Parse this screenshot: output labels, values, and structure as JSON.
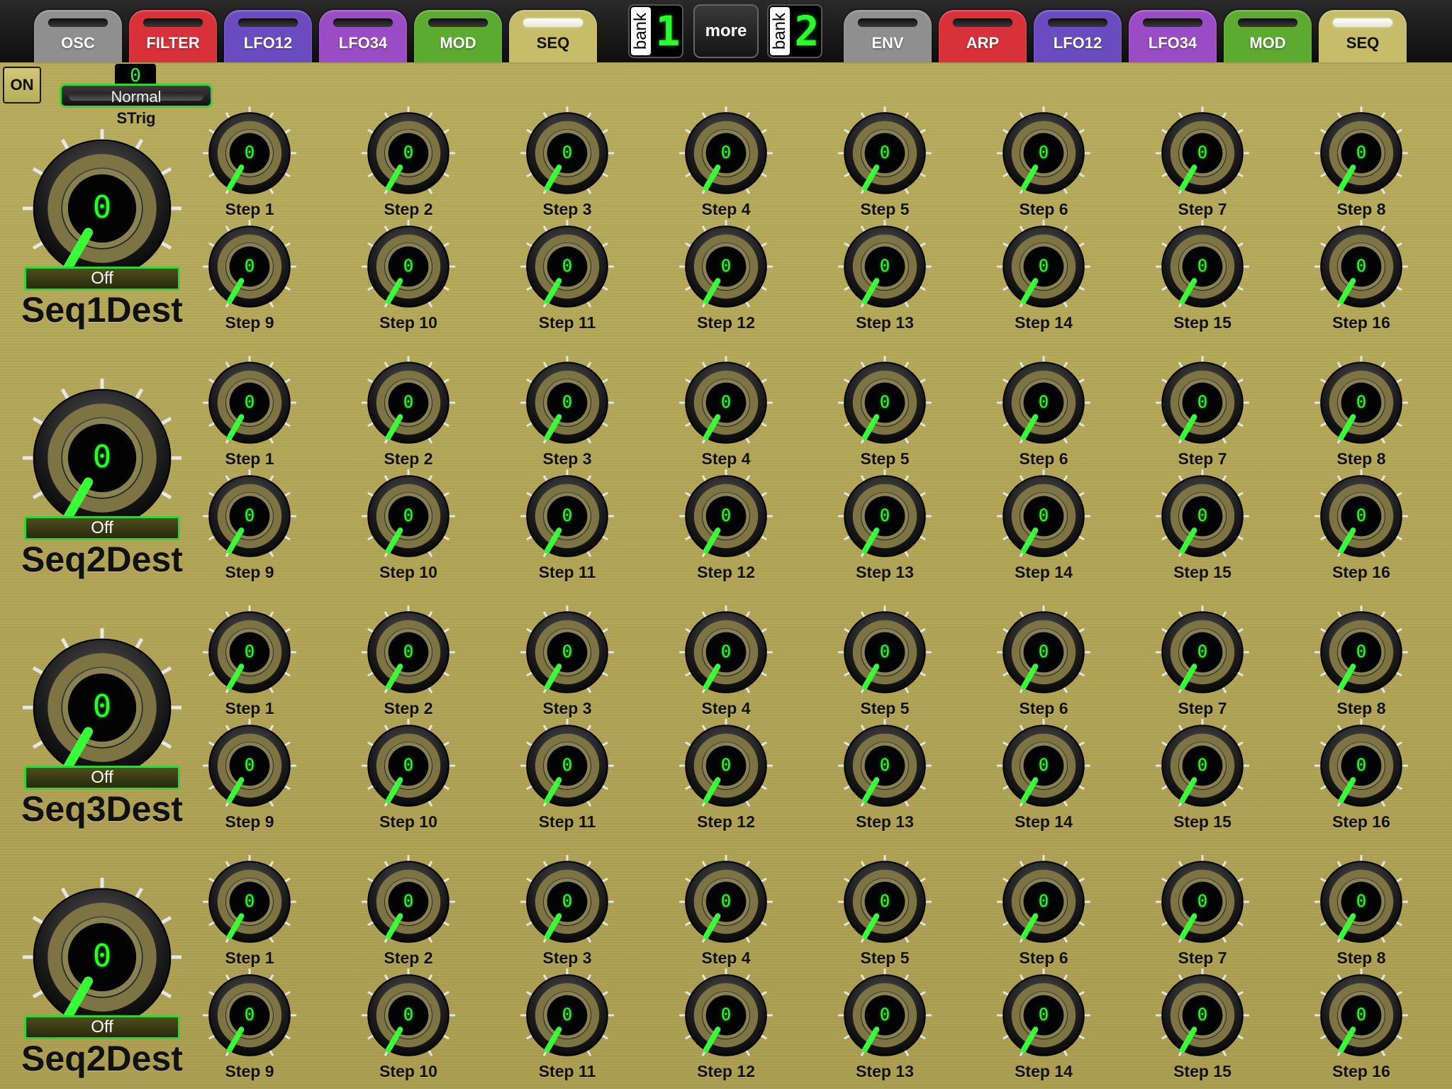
{
  "tabs_left": [
    {
      "label": "OSC",
      "color": "#8f8f8f",
      "active": false
    },
    {
      "label": "FILTER",
      "color": "#d8313a",
      "active": false
    },
    {
      "label": "LFO12",
      "color": "#6a4cc0",
      "active": false
    },
    {
      "label": "LFO34",
      "color": "#9a4cc4",
      "active": false
    },
    {
      "label": "MOD",
      "color": "#5caa30",
      "active": false
    },
    {
      "label": "SEQ",
      "color": "#c6bc6a",
      "active": true
    }
  ],
  "tabs_right": [
    {
      "label": "ENV",
      "color": "#8f8f8f",
      "active": false
    },
    {
      "label": "ARP",
      "color": "#d8313a",
      "active": false
    },
    {
      "label": "LFO12",
      "color": "#6a4cc0",
      "active": false
    },
    {
      "label": "LFO34",
      "color": "#9a4cc4",
      "active": false
    },
    {
      "label": "MOD",
      "color": "#5caa30",
      "active": false
    },
    {
      "label": "SEQ",
      "color": "#c6bc6a",
      "active": true
    }
  ],
  "bank1": {
    "label": "bank",
    "value": "1"
  },
  "bank2": {
    "label": "bank",
    "value": "2"
  },
  "more_label": "more",
  "on_label": "ON",
  "strig": {
    "value": "0",
    "mode": "Normal",
    "label": "STrig"
  },
  "sequencers": [
    {
      "dest_label": "Seq1Dest",
      "dest_value": "0",
      "dest_option": "Off",
      "steps": [
        {
          "label": "Step 1",
          "value": "0"
        },
        {
          "label": "Step 2",
          "value": "0"
        },
        {
          "label": "Step 3",
          "value": "0"
        },
        {
          "label": "Step 4",
          "value": "0"
        },
        {
          "label": "Step 5",
          "value": "0"
        },
        {
          "label": "Step 6",
          "value": "0"
        },
        {
          "label": "Step 7",
          "value": "0"
        },
        {
          "label": "Step 8",
          "value": "0"
        },
        {
          "label": "Step 9",
          "value": "0"
        },
        {
          "label": "Step 10",
          "value": "0"
        },
        {
          "label": "Step 11",
          "value": "0"
        },
        {
          "label": "Step 12",
          "value": "0"
        },
        {
          "label": "Step 13",
          "value": "0"
        },
        {
          "label": "Step 14",
          "value": "0"
        },
        {
          "label": "Step 15",
          "value": "0"
        },
        {
          "label": "Step 16",
          "value": "0"
        }
      ]
    },
    {
      "dest_label": "Seq2Dest",
      "dest_value": "0",
      "dest_option": "Off",
      "steps": [
        {
          "label": "Step 1",
          "value": "0"
        },
        {
          "label": "Step 2",
          "value": "0"
        },
        {
          "label": "Step 3",
          "value": "0"
        },
        {
          "label": "Step 4",
          "value": "0"
        },
        {
          "label": "Step 5",
          "value": "0"
        },
        {
          "label": "Step 6",
          "value": "0"
        },
        {
          "label": "Step 7",
          "value": "0"
        },
        {
          "label": "Step 8",
          "value": "0"
        },
        {
          "label": "Step 9",
          "value": "0"
        },
        {
          "label": "Step 10",
          "value": "0"
        },
        {
          "label": "Step 11",
          "value": "0"
        },
        {
          "label": "Step 12",
          "value": "0"
        },
        {
          "label": "Step 13",
          "value": "0"
        },
        {
          "label": "Step 14",
          "value": "0"
        },
        {
          "label": "Step 15",
          "value": "0"
        },
        {
          "label": "Step 16",
          "value": "0"
        }
      ]
    },
    {
      "dest_label": "Seq3Dest",
      "dest_value": "0",
      "dest_option": "Off",
      "steps": [
        {
          "label": "Step 1",
          "value": "0"
        },
        {
          "label": "Step 2",
          "value": "0"
        },
        {
          "label": "Step 3",
          "value": "0"
        },
        {
          "label": "Step 4",
          "value": "0"
        },
        {
          "label": "Step 5",
          "value": "0"
        },
        {
          "label": "Step 6",
          "value": "0"
        },
        {
          "label": "Step 7",
          "value": "0"
        },
        {
          "label": "Step 8",
          "value": "0"
        },
        {
          "label": "Step 9",
          "value": "0"
        },
        {
          "label": "Step 10",
          "value": "0"
        },
        {
          "label": "Step 11",
          "value": "0"
        },
        {
          "label": "Step 12",
          "value": "0"
        },
        {
          "label": "Step 13",
          "value": "0"
        },
        {
          "label": "Step 14",
          "value": "0"
        },
        {
          "label": "Step 15",
          "value": "0"
        },
        {
          "label": "Step 16",
          "value": "0"
        }
      ]
    },
    {
      "dest_label": "Seq2Dest",
      "dest_value": "0",
      "dest_option": "Off",
      "steps": [
        {
          "label": "Step 1",
          "value": "0"
        },
        {
          "label": "Step 2",
          "value": "0"
        },
        {
          "label": "Step 3",
          "value": "0"
        },
        {
          "label": "Step 4",
          "value": "0"
        },
        {
          "label": "Step 5",
          "value": "0"
        },
        {
          "label": "Step 6",
          "value": "0"
        },
        {
          "label": "Step 7",
          "value": "0"
        },
        {
          "label": "Step 8",
          "value": "0"
        },
        {
          "label": "Step 9",
          "value": "0"
        },
        {
          "label": "Step 10",
          "value": "0"
        },
        {
          "label": "Step 11",
          "value": "0"
        },
        {
          "label": "Step 12",
          "value": "0"
        },
        {
          "label": "Step 13",
          "value": "0"
        },
        {
          "label": "Step 14",
          "value": "0"
        },
        {
          "label": "Step 15",
          "value": "0"
        },
        {
          "label": "Step 16",
          "value": "0"
        }
      ]
    }
  ],
  "colors": {
    "accent_green": "#2bff2b",
    "panel_gold": "#b3a656"
  }
}
